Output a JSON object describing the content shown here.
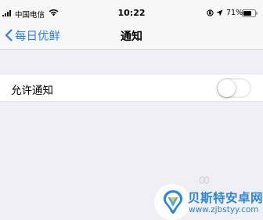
{
  "status_bar": {
    "carrier": "中国电信",
    "time": "10:22",
    "battery_percent": "71%",
    "battery_level": 0.71,
    "icons": [
      "signal-bars-icon",
      "wifi-icon",
      "orientation-lock-icon",
      "location-icon",
      "battery-icon"
    ]
  },
  "nav": {
    "back_label": "每日优鲜",
    "title": "通知"
  },
  "settings": {
    "allow_notifications_label": "允许通知",
    "allow_notifications_on": false
  },
  "watermark": {
    "title": "贝斯特安卓网",
    "url": "www.zjbstyy.com"
  },
  "colors": {
    "accent": "#2f7cf6",
    "background": "#efeff4",
    "watermark_blue": "#2a86d6"
  }
}
